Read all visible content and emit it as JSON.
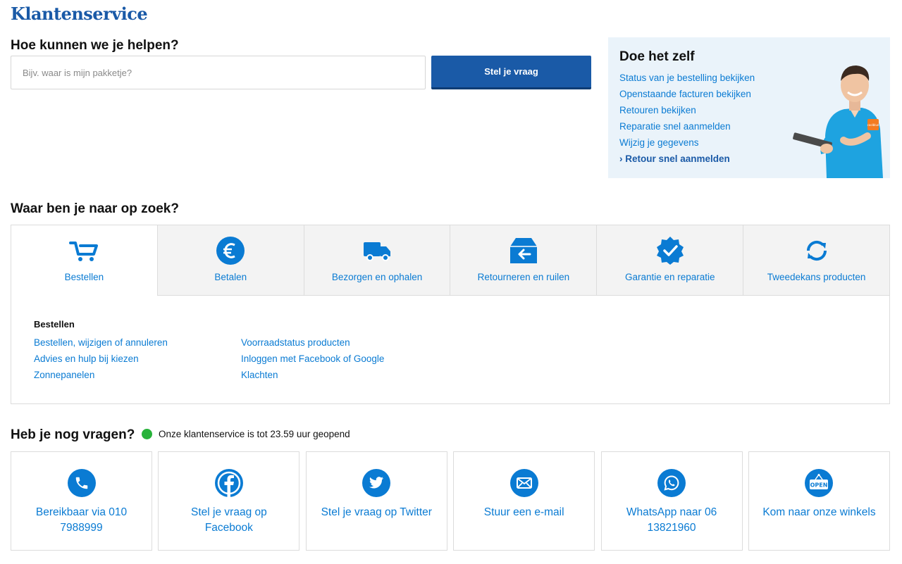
{
  "brand": "Klantenservice",
  "help": {
    "title": "Hoe kunnen we je helpen?",
    "search_placeholder": "Bijv. waar is mijn pakketje?",
    "button_label": "Stel je vraag"
  },
  "diy": {
    "title": "Doe het zelf",
    "links": [
      "Status van je bestelling bekijken",
      "Openstaande facturen bekijken",
      "Retouren bekijken",
      "Reparatie snel aanmelden",
      "Wijzig je gegevens"
    ],
    "highlight_link": "Retour snel aanmelden",
    "badge_text": "coolblue"
  },
  "categories": {
    "title": "Waar ben je naar op zoek?",
    "tabs": [
      {
        "label": "Bestellen",
        "icon": "cart-icon"
      },
      {
        "label": "Betalen",
        "icon": "euro-icon"
      },
      {
        "label": "Bezorgen en ophalen",
        "icon": "truck-icon"
      },
      {
        "label": "Retourneren en ruilen",
        "icon": "return-box-icon"
      },
      {
        "label": "Garantie en reparatie",
        "icon": "warranty-badge-icon"
      },
      {
        "label": "Tweedekans producten",
        "icon": "refresh-icon"
      }
    ],
    "active_tab": "Bestellen",
    "panel_title": "Bestellen",
    "col1": [
      "Bestellen, wijzigen of annuleren",
      "Advies en hulp bij kiezen",
      "Zonnepanelen"
    ],
    "col2": [
      "Voorraadstatus producten",
      "Inloggen met Facebook of Google",
      "Klachten"
    ]
  },
  "contact": {
    "title": "Heb je nog vragen?",
    "status_text": "Onze klantenservice is tot 23.59 uur geopend",
    "open_sign_text": "OPEN",
    "cards": [
      {
        "label": "Bereikbaar via 010 7988999",
        "icon": "phone-icon"
      },
      {
        "label": "Stel je vraag op Facebook",
        "icon": "facebook-icon"
      },
      {
        "label": "Stel je vraag op Twitter",
        "icon": "twitter-icon"
      },
      {
        "label": "Stuur een e-mail",
        "icon": "mail-icon"
      },
      {
        "label": "WhatsApp naar 06 13821960",
        "icon": "whatsapp-icon"
      },
      {
        "label": "Kom naar onze winkels",
        "icon": "open-sign-icon"
      }
    ]
  },
  "colors": {
    "brand_blue": "#1a5aa7",
    "link_blue": "#0a7bd3",
    "diy_bg": "#eaf3fa",
    "tab_bg": "#f3f3f3",
    "status_green": "#27b23a",
    "accent_orange": "#f47b20"
  }
}
